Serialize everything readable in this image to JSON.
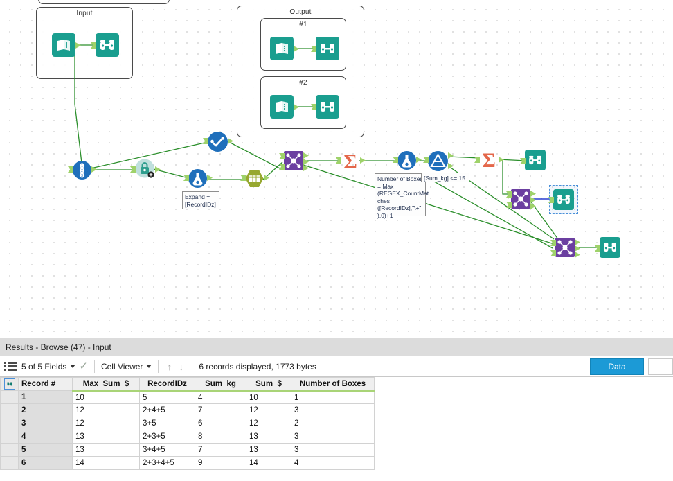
{
  "canvas": {
    "containers": [
      {
        "name": "input-container",
        "label": "Input"
      },
      {
        "name": "output-container",
        "label": "Output"
      },
      {
        "name": "output-sub-1",
        "label": "#1"
      },
      {
        "name": "output-sub-2",
        "label": "#2"
      }
    ],
    "annotations": [
      {
        "name": "number-of-boxes-formula",
        "text": "Number of Boxes = Max (REGEX_CountMat ches ([RecordIDz],\"\\+\" ),0)+1"
      },
      {
        "name": "filter-expression",
        "text": "[Sum_kg] <= 15"
      },
      {
        "name": "expand-annotation",
        "text": "Expand = [RecordIDz]"
      }
    ],
    "tools": [
      {
        "name": "text-input-tool-input",
        "icon": "book-icon"
      },
      {
        "name": "browse-tool-input",
        "icon": "binoculars-icon"
      },
      {
        "name": "text-input-tool-output-1",
        "icon": "book-icon"
      },
      {
        "name": "browse-tool-output-1",
        "icon": "binoculars-icon"
      },
      {
        "name": "text-input-tool-output-2",
        "icon": "book-icon"
      },
      {
        "name": "browse-tool-output-2",
        "icon": "binoculars-icon"
      },
      {
        "name": "record-id-tool",
        "icon": "record-id-icon"
      },
      {
        "name": "macro-tool",
        "icon": "lock-icon"
      },
      {
        "name": "select-tool",
        "icon": "check-icon"
      },
      {
        "name": "generate-rows-tool",
        "icon": "flask-icon"
      },
      {
        "name": "text-to-columns-tool",
        "icon": "table-icon"
      },
      {
        "name": "join-tool-1",
        "icon": "join-icon"
      },
      {
        "name": "summarize-tool-1",
        "icon": "sigma-icon"
      },
      {
        "name": "formula-tool",
        "icon": "flask-icon"
      },
      {
        "name": "filter-tool",
        "icon": "filter-icon"
      },
      {
        "name": "summarize-tool-2",
        "icon": "sigma-icon"
      },
      {
        "name": "browse-tool-right-top",
        "icon": "binoculars-icon"
      },
      {
        "name": "join-tool-2",
        "icon": "join-icon"
      },
      {
        "name": "browse-tool-selected",
        "icon": "binoculars-icon"
      },
      {
        "name": "join-tool-3",
        "icon": "join-icon"
      },
      {
        "name": "browse-tool-bottom",
        "icon": "binoculars-icon"
      }
    ],
    "colors": {
      "tool_teal": "#1a9e8f",
      "tool_blue": "#1f6fbb",
      "tool_purple": "#6b3fa0",
      "tool_orange": "#e4674a",
      "tool_olive": "#97a830",
      "connector_green": "#2c8f2c",
      "connector_blue": "#2a3fd0",
      "selection_blue": "#4a90d9"
    }
  },
  "results": {
    "title": "Results - Browse (47) - Input",
    "toolbar": {
      "fields_label": "5 of 5 Fields",
      "viewer_label": "Cell Viewer",
      "status": "6 records displayed, 1773 bytes",
      "data_button": "Data",
      "sort_up_icon": "arrow-up-icon",
      "sort_down_icon": "arrow-down-icon",
      "check_icon": "check-icon",
      "fields_icon": "field-list-icon"
    },
    "table": {
      "columns": [
        "Record #",
        "Max_Sum_$",
        "RecordIDz",
        "Sum_kg",
        "Sum_$",
        "Number of Boxes"
      ],
      "rows": [
        [
          "1",
          "10",
          "5",
          "4",
          "10",
          "1"
        ],
        [
          "2",
          "12",
          "2+4+5",
          "7",
          "12",
          "3"
        ],
        [
          "3",
          "12",
          "3+5",
          "6",
          "12",
          "2"
        ],
        [
          "4",
          "13",
          "2+3+5",
          "8",
          "13",
          "3"
        ],
        [
          "5",
          "13",
          "3+4+5",
          "7",
          "13",
          "3"
        ],
        [
          "6",
          "14",
          "2+3+4+5",
          "9",
          "14",
          "4"
        ]
      ]
    }
  }
}
